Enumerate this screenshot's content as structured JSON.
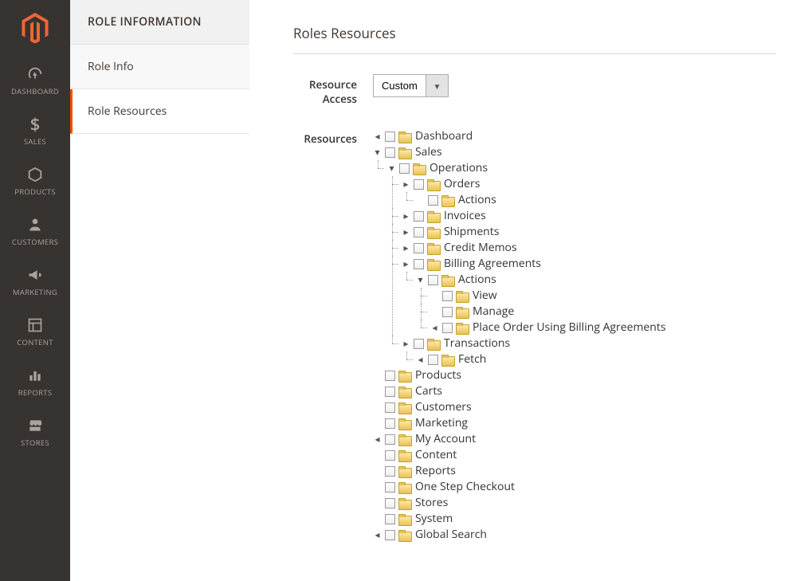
{
  "admin_nav": [
    {
      "label": "DASHBOARD",
      "icon": "dashboard"
    },
    {
      "label": "SALES",
      "icon": "sales"
    },
    {
      "label": "PRODUCTS",
      "icon": "products"
    },
    {
      "label": "CUSTOMERS",
      "icon": "customers"
    },
    {
      "label": "MARKETING",
      "icon": "marketing"
    },
    {
      "label": "CONTENT",
      "icon": "content"
    },
    {
      "label": "REPORTS",
      "icon": "reports"
    },
    {
      "label": "STORES",
      "icon": "stores"
    }
  ],
  "side_panel": {
    "header": "ROLE INFORMATION",
    "items": [
      {
        "label": "Role Info",
        "active": false
      },
      {
        "label": "Role Resources",
        "active": true
      }
    ]
  },
  "section_title": "Roles Resources",
  "resource_access": {
    "label": "Resource Access",
    "value": "Custom"
  },
  "resources_label": "Resources",
  "tree": [
    {
      "label": "Dashboard",
      "t": "end"
    },
    {
      "label": "Sales",
      "t": "open",
      "children": [
        {
          "label": "Operations",
          "t": "open",
          "children": [
            {
              "label": "Orders",
              "t": "closed",
              "children": [
                {
                  "label": "Actions",
                  "t": "leaf"
                }
              ]
            },
            {
              "label": "Invoices",
              "t": "closed"
            },
            {
              "label": "Shipments",
              "t": "closed"
            },
            {
              "label": "Credit Memos",
              "t": "closed"
            },
            {
              "label": "Billing Agreements",
              "t": "closed",
              "children": [
                {
                  "label": "Actions",
                  "t": "open",
                  "children": [
                    {
                      "label": "View",
                      "t": "leaf"
                    },
                    {
                      "label": "Manage",
                      "t": "leaf"
                    },
                    {
                      "label": "Place Order Using Billing Agreements",
                      "t": "end"
                    }
                  ]
                }
              ]
            },
            {
              "label": "Transactions",
              "t": "closed",
              "children": [
                {
                  "label": "Fetch",
                  "t": "end"
                }
              ]
            }
          ]
        }
      ]
    },
    {
      "label": "Products",
      "t": "leaf"
    },
    {
      "label": "Carts",
      "t": "leaf"
    },
    {
      "label": "Customers",
      "t": "leaf"
    },
    {
      "label": "Marketing",
      "t": "leaf"
    },
    {
      "label": "My Account",
      "t": "end"
    },
    {
      "label": "Content",
      "t": "leaf"
    },
    {
      "label": "Reports",
      "t": "leaf"
    },
    {
      "label": "One Step Checkout",
      "t": "leaf"
    },
    {
      "label": "Stores",
      "t": "leaf"
    },
    {
      "label": "System",
      "t": "leaf"
    },
    {
      "label": "Global Search",
      "t": "end"
    }
  ]
}
